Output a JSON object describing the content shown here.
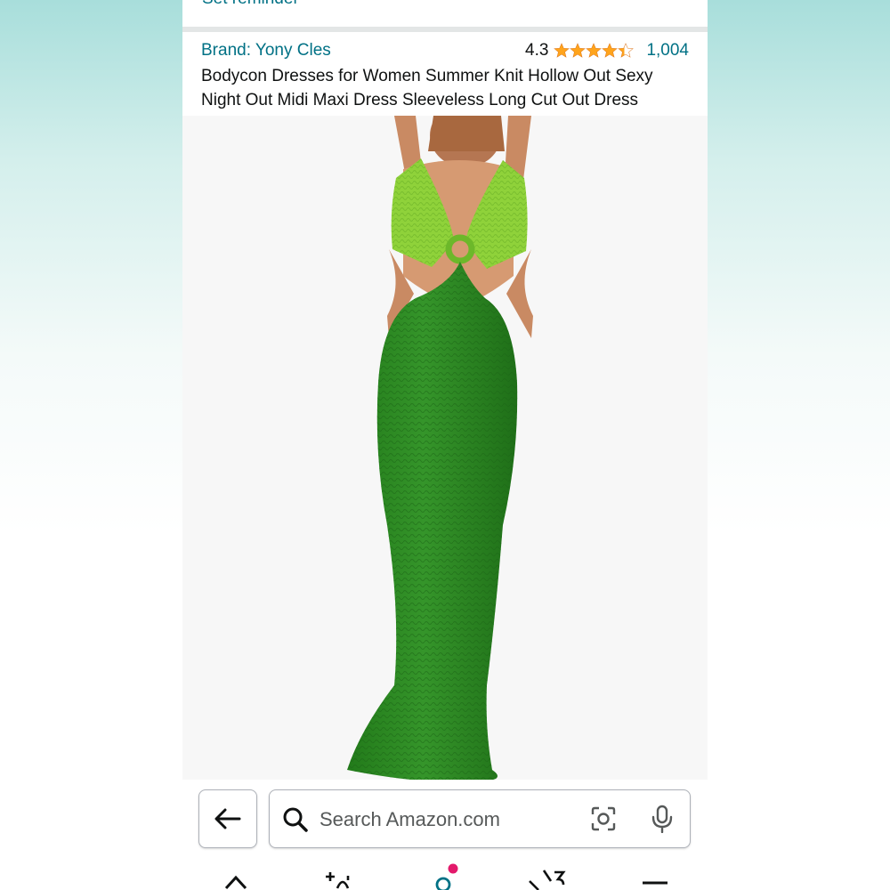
{
  "reminder": {
    "label": "Set reminder"
  },
  "product": {
    "brand": "Brand: Yony Cles",
    "rating": "4.3",
    "rating_stars": 4.3,
    "review_count": "1,004",
    "title": "Bodycon Dresses for Women Summer Knit Hollow Out Sexy Night Out Midi Maxi Dress Sleeveless Long Cut Out Dress"
  },
  "search": {
    "placeholder": "Search Amazon.com"
  },
  "colors": {
    "link": "#007185",
    "star": "#ffa41c",
    "dress_dark": "#2f8a24",
    "dress_light": "#8fd23a",
    "notification_dot": "#e3196b"
  },
  "icons": {
    "back": "left-arrow-icon",
    "search": "search-icon",
    "lens": "camera-lens-icon",
    "mic": "microphone-icon",
    "nav": [
      "home-icon",
      "spark-icon",
      "account-icon",
      "cart-icon",
      "menu-icon"
    ]
  }
}
